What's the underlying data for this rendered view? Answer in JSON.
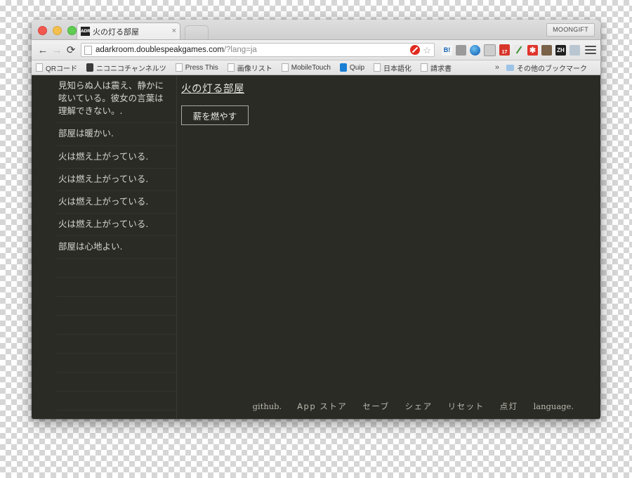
{
  "browser": {
    "window_controls": [
      "close",
      "minimize",
      "maximize"
    ],
    "tab": {
      "favicon_label": "ADR",
      "title": "火の灯る部屋",
      "close_label": "×"
    },
    "profile_label": "MOONGIFT",
    "nav": {
      "back_glyph": "←",
      "forward_glyph": "→",
      "reload_glyph": "⟳"
    },
    "omnibox": {
      "url_main": "adarkroom.doublespeakgames.com",
      "url_query": "/?lang=ja",
      "star_glyph": "☆"
    },
    "extensions": [
      {
        "name": "adblock-icon",
        "label": "",
        "color": "#e02b20"
      },
      {
        "name": "hatena-bookmark-icon",
        "label": "B!",
        "color": "#f2f2f2",
        "text_color": "#0c5fb3"
      },
      {
        "name": "evernote-clipper-icon",
        "label": "",
        "color": "#8e8e8e"
      },
      {
        "name": "globe-icon",
        "label": "",
        "color": "#2f7fd4"
      },
      {
        "name": "window-capture-icon",
        "label": "",
        "color": "#c7c7c7"
      },
      {
        "name": "todoist-icon",
        "label": "17",
        "color": "#d8352a"
      },
      {
        "name": "eyedropper-icon",
        "label": "",
        "color": "#4c9a3f"
      },
      {
        "name": "asterisk-icon",
        "label": "✱",
        "color": "#e0352b"
      },
      {
        "name": "camera-icon",
        "label": "",
        "color": "#6b5742"
      },
      {
        "name": "zh-translate-icon",
        "label": "ZH",
        "color": "#1a1a1a"
      },
      {
        "name": "tab-copy-icon",
        "label": "",
        "color": "#b8c4cf"
      }
    ],
    "bookmarks": [
      {
        "label": "QRコード",
        "icon": "doc"
      },
      {
        "label": "ニコニコチャンネルツ",
        "icon": "nicovideo"
      },
      {
        "label": "Press This",
        "icon": "doc"
      },
      {
        "label": "画像リスト",
        "icon": "doc"
      },
      {
        "label": "MobileTouch",
        "icon": "doc"
      },
      {
        "label": "Quip",
        "icon": "quip"
      },
      {
        "label": "日本語化",
        "icon": "doc"
      },
      {
        "label": "請求書",
        "icon": "doc"
      }
    ],
    "bookmarks_overflow_glyph": "»",
    "other_bookmarks_label": "その他のブックマーク"
  },
  "page": {
    "log_entries": [
      "見知らぬ人は震え、静かに呟いている。彼女の言葉は理解できない。.",
      "部屋は暖かい.",
      "火は燃え上がっている.",
      "火は燃え上がっている.",
      "火は燃え上がっている.",
      "火は燃え上がっている.",
      "部屋は心地よい."
    ],
    "blank_log_rows": 9,
    "room_title": "火の灯る部屋",
    "stoke_button_label": "薪を燃やす",
    "footer_items": [
      {
        "label": "github.",
        "style": "serif"
      },
      {
        "label": "App ストア",
        "style": "jp"
      },
      {
        "label": "セーブ",
        "style": "jp"
      },
      {
        "label": "シェア",
        "style": "jp"
      },
      {
        "label": "リセット",
        "style": "jp"
      },
      {
        "label": "点灯",
        "style": "jp"
      },
      {
        "label": "language.",
        "style": "serif"
      }
    ],
    "colors": {
      "background": "#2b2b26",
      "text": "#d6d6d0",
      "muted_text": "#b9b9ae",
      "divider": "#34342e"
    }
  }
}
